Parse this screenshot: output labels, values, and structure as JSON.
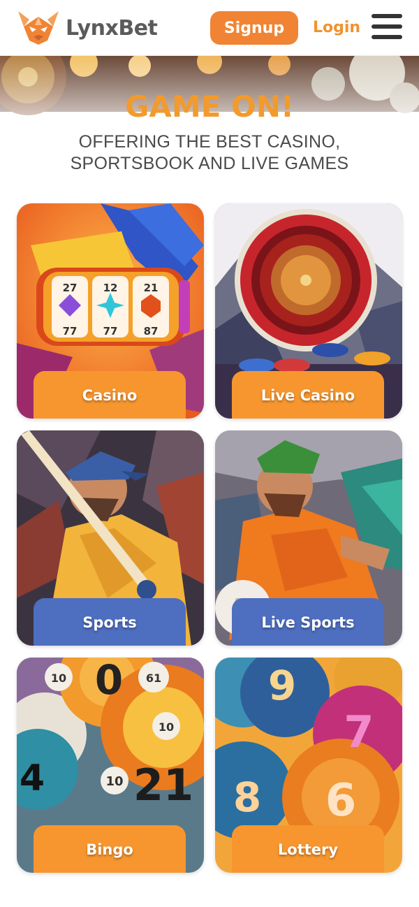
{
  "header": {
    "brand": "LynxBet",
    "signup_label": "Signup",
    "login_label": "Login"
  },
  "hero": {
    "title": "GAME ON!",
    "subtitle": "OFFERING THE BEST CASINO, SPORTSBOOK AND LIVE GAMES"
  },
  "tiles": [
    {
      "label": "Casino",
      "style": "orange"
    },
    {
      "label": "Live Casino",
      "style": "orange"
    },
    {
      "label": "Sports",
      "style": "blue"
    },
    {
      "label": "Live Sports",
      "style": "blue"
    },
    {
      "label": "Bingo",
      "style": "orange"
    },
    {
      "label": "Lottery",
      "style": "orange"
    }
  ],
  "art_text": {
    "slot_top": [
      "27",
      "12",
      "21"
    ],
    "slot_bottom": [
      "77",
      "77",
      "87"
    ],
    "bingo_balls": [
      "10",
      "0",
      "61",
      "4",
      "10",
      "21",
      "10"
    ],
    "lottery_balls": [
      "9",
      "7",
      "8",
      "6"
    ]
  },
  "colors": {
    "accent": "#f08434",
    "title": "#f39a2c",
    "tile_orange": "#f7962e",
    "tile_blue": "#4e6ec0"
  }
}
